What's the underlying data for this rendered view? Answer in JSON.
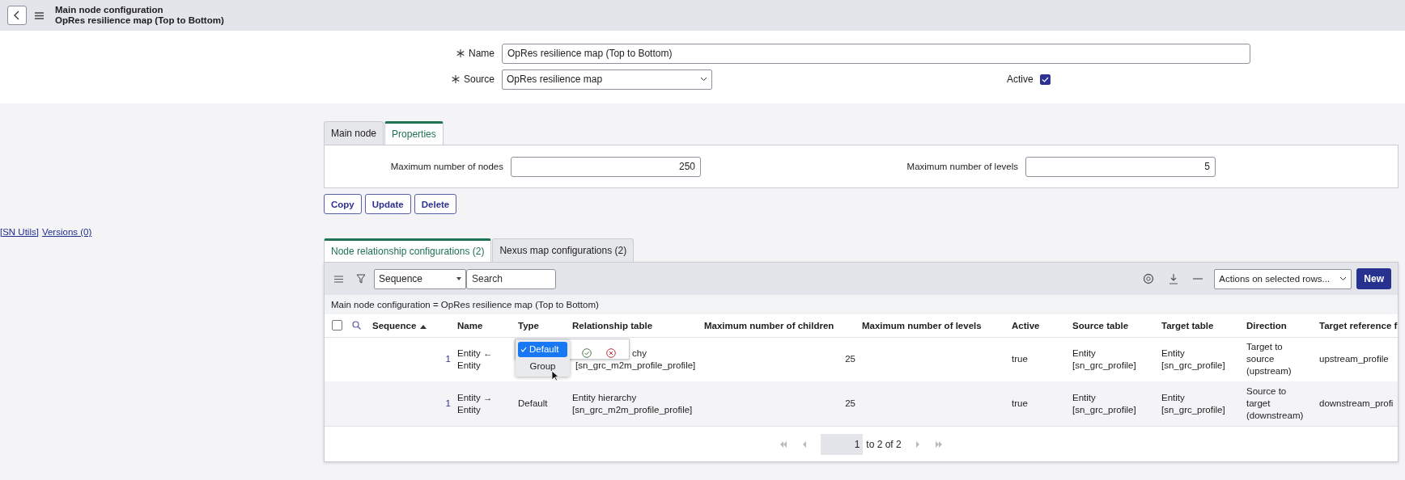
{
  "header": {
    "title": "Main node configuration",
    "subtitle": "OpRes resilience map (Top to Bottom)"
  },
  "form": {
    "name": {
      "label": "Name",
      "value": "OpRes resilience map (Top to Bottom)"
    },
    "source": {
      "label": "Source",
      "value": "OpRes resilience map"
    },
    "active": {
      "label": "Active",
      "checked": true
    }
  },
  "form_tabs": [
    {
      "label": "Main node",
      "selected": false
    },
    {
      "label": "Properties",
      "selected": true
    }
  ],
  "properties": [
    {
      "label": "Maximum number of nodes",
      "value": "250"
    },
    {
      "label": "Maximum number of levels",
      "value": "5"
    }
  ],
  "buttons": [
    "Copy",
    "Update",
    "Delete"
  ],
  "utility_links": [
    "[SN Utils]",
    "Versions (0)"
  ],
  "related_tabs": [
    {
      "label": "Node relationship configurations (2)",
      "selected": true
    },
    {
      "label": "Nexus map configurations (2)",
      "selected": false
    }
  ],
  "list": {
    "select_all_checked": false,
    "filter_field": "Sequence",
    "search_placeholder": "Search",
    "actions": "Actions on selected rows...",
    "new_button": "New",
    "breadcrumb": "Main node configuration = OpRes resilience map (Top to Bottom)",
    "columns": [
      "Sequence",
      "Name",
      "Type",
      "Relationship table",
      "Maximum number of children",
      "Maximum number of levels",
      "Active",
      "Source table",
      "Target table",
      "Direction",
      "Target reference f"
    ],
    "rows": [
      {
        "cells": [
          "1",
          "Entity ←\nEntity",
          null,
          "chy\n[sn_grc_m2m_profile_profile]",
          "25",
          null,
          "true",
          "Entity\n[sn_grc_profile]",
          "Entity\n[sn_grc_profile]",
          "Target to\nsource\n(upstream)",
          "upstream_profile"
        ]
      },
      {
        "cells": [
          "1",
          "Entity →\nEntity",
          "Default",
          "Entity hierarchy\n[sn_grc_m2m_profile_profile]",
          "25",
          null,
          "true",
          "Entity\n[sn_grc_profile]",
          "Entity\n[sn_grc_profile]",
          "Source to\ntarget\n(downstream)",
          "downstream_profi"
        ]
      }
    ],
    "type_editor": {
      "options": [
        {
          "label": "Default",
          "selected": true
        },
        {
          "label": "Group",
          "selected": false
        }
      ]
    },
    "pagination": {
      "page": "1",
      "range": "to 2 of 2"
    }
  }
}
